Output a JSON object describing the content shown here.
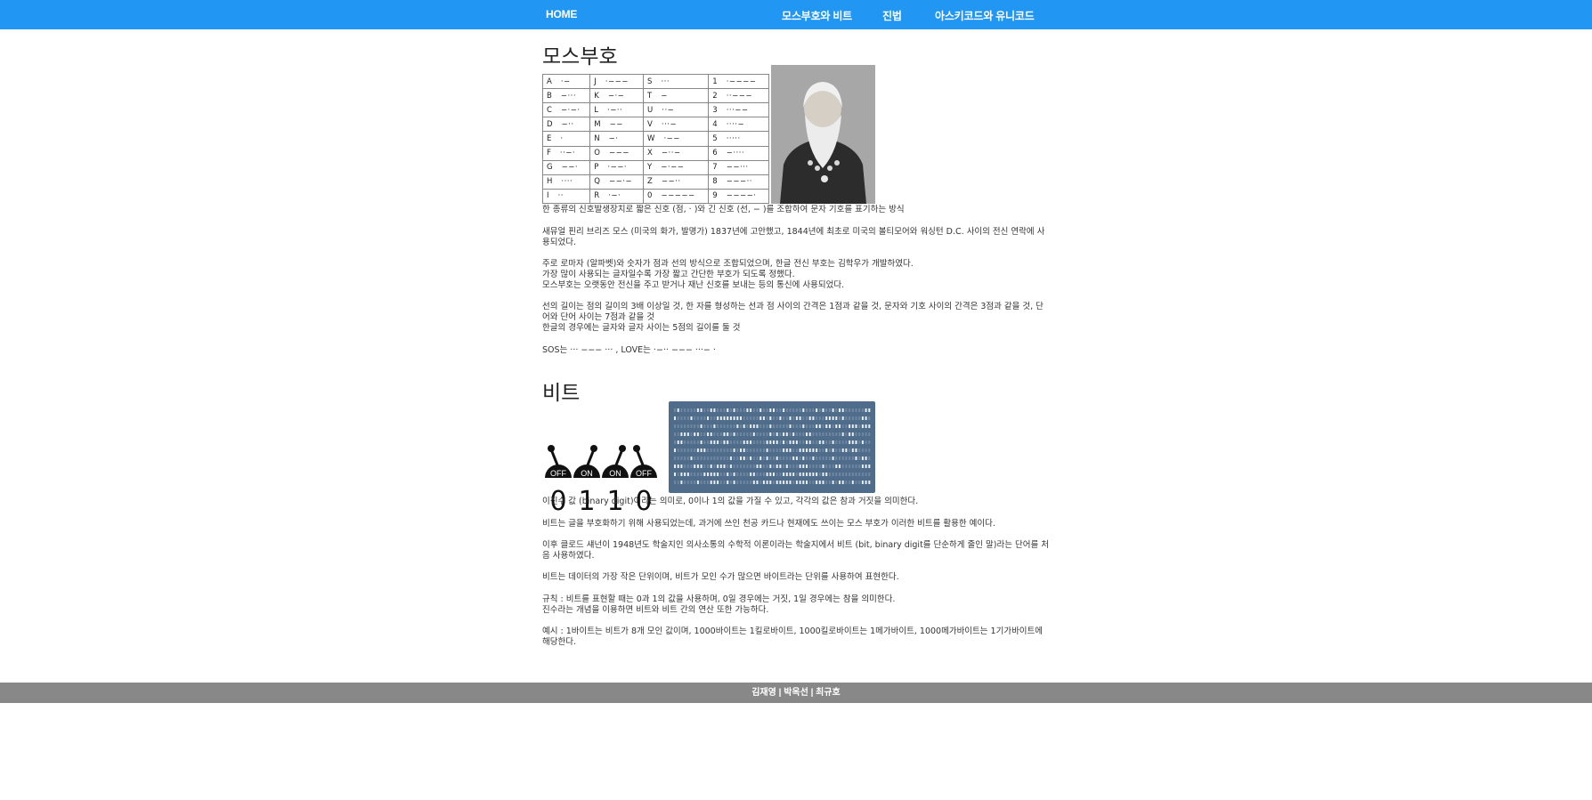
{
  "nav": {
    "home": "HOME",
    "morse_bit": "모스부호와 비트",
    "base": "진법",
    "ascii_unicode": "아스키코드와 유니코드"
  },
  "morse": {
    "title": "모스부호",
    "table": [
      [
        [
          "A",
          "·−"
        ],
        [
          "J",
          "·−−−"
        ],
        [
          "S",
          "···"
        ],
        [
          "1",
          "·−−−−"
        ]
      ],
      [
        [
          "B",
          "−···"
        ],
        [
          "K",
          "−·−"
        ],
        [
          "T",
          "−"
        ],
        [
          "2",
          "··−−−"
        ]
      ],
      [
        [
          "C",
          "−·−·"
        ],
        [
          "L",
          "·−··"
        ],
        [
          "U",
          "··−"
        ],
        [
          "3",
          "···−−"
        ]
      ],
      [
        [
          "D",
          "−··"
        ],
        [
          "M",
          "−−"
        ],
        [
          "V",
          "···−"
        ],
        [
          "4",
          "····−"
        ]
      ],
      [
        [
          "E",
          "·"
        ],
        [
          "N",
          "−·"
        ],
        [
          "W",
          "·−−"
        ],
        [
          "5",
          "·····"
        ]
      ],
      [
        [
          "F",
          "··−·"
        ],
        [
          "O",
          "−−−"
        ],
        [
          "X",
          "−··−"
        ],
        [
          "6",
          "−····"
        ]
      ],
      [
        [
          "G",
          "−−·"
        ],
        [
          "P",
          "·−−·"
        ],
        [
          "Y",
          "−·−−"
        ],
        [
          "7",
          "−−···"
        ]
      ],
      [
        [
          "H",
          "····"
        ],
        [
          "Q",
          "−−·−"
        ],
        [
          "Z",
          "−−··"
        ],
        [
          "8",
          "−−−··"
        ]
      ],
      [
        [
          "I",
          "··"
        ],
        [
          "R",
          "·−·"
        ],
        [
          "0",
          "−−−−−"
        ],
        [
          "9",
          "−−−−·"
        ]
      ]
    ],
    "p1": "한 종류의 신호발생장치로 짧은 신호 (점, · )와 긴 신호 (선, − )를 조합하여 문자 기호를 표기하는 방식",
    "p2": "새뮤얼 핀리 브리즈 모스 (미국의 화가, 발명가) 1837년에 고안했고, 1844년에 최초로 미국의 볼티모어와 워싱턴 D.C. 사이의 전신 연락에 사용되었다.",
    "p3a": "주로 로마자 (알파벳)와 숫자가 점과 선의 방식으로 조합되었으며, 한글 전신 부호는 김학우가 개발하였다.",
    "p3b": "가장 많이 사용되는 글자일수록 가장 짧고 간단한 부호가 되도록 정했다.",
    "p3c": "모스부호는 오랫동안 전신을 주고 받거나 재난 신호를 보내는 등의 통신에 사용되었다.",
    "p4a": "선의 길이는 점의 길이의 3배 이상일 것, 한 자를 형성하는 선과 점 사이의 간격은 1점과 같을 것, 문자와 기호 사이의 간격은 3점과 같을 것, 단어와 단어 사이는 7점과 같을 것",
    "p4b": "한글의 경우에는 글자와 글자 사이는 5점의 길이를 둘 것",
    "p5": "SOS는 ··· −−− ··· , LOVE는 ·−·· −−− ···− ·"
  },
  "bit": {
    "title": "비트",
    "switches": [
      {
        "state": "OFF",
        "digit": "0"
      },
      {
        "state": "ON",
        "digit": "1"
      },
      {
        "state": "ON",
        "digit": "1"
      },
      {
        "state": "OFF",
        "digit": "0"
      }
    ],
    "p1": "이진수 값 (binary digit)이라는 의미로, 0이나 1의 값을 가질 수 있고, 각각의 값은 참과 거짓을 의미한다.",
    "p2a": "비트는 글을 부호화하기 위해 사용되었는데, 과거에 쓰인 천공 카드나 현재에도 쓰이는 모스 부호가 이러한 비트를 활용한 예이다.",
    "p2b": "이후 클로드 섀넌이 1948년도 학술지인 의사소통의 수학적 이론이라는 학술지에서 비트 (bit, binary digit를 단순하게 줄인 말)라는 단어를 처음 사용하였다.",
    "p3": "비트는 데이터의 가장 작은 단위이며, 비트가 모인 수가 많으면 바이트라는 단위를 사용하여 표현한다.",
    "p4a": "규칙 : 비트를 표현할 때는 0과 1의 값을 사용하며, 0일 경우에는 거짓, 1일 경우에는 참을 의미한다.",
    "p4b": "진수라는 개념을 이용하면 비트와 비트 간의 연산 또한 가능하다.",
    "p5": "예시 : 1바이트는 비트가 8개 모인 값이며, 1000바이트는 1킬로바이트, 1000킬로바이트는 1메가바이트, 1000메가바이트는 1기가바이트에 해당한다."
  },
  "footer": {
    "text": "김재영 | 박옥선 | 최규호"
  }
}
